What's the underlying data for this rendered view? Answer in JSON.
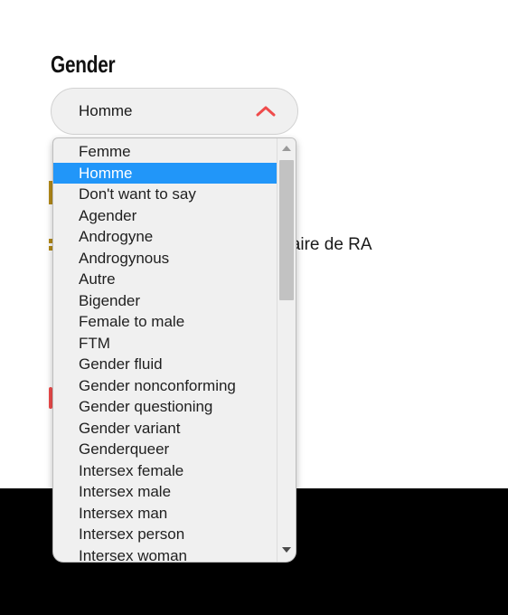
{
  "page": {
    "heading": "Gender",
    "background_text": "hebdomadaire de RA"
  },
  "select": {
    "name": "gender-select",
    "value": "Homme",
    "expanded": true,
    "toggle_icon": "chevron-up-icon",
    "accent_color": "#ef4b4b",
    "background_color": "#f0f0f0"
  },
  "dropdown": {
    "highlight_color": "#2196f9",
    "selected_value": "Homme",
    "scrollbar": {
      "up_icon": "scroll-up-arrow-icon",
      "down_icon": "scroll-down-arrow-icon",
      "thumb": "scrollbar-thumb"
    },
    "options": [
      "Femme",
      "Homme",
      "Don't want to say",
      "Agender",
      "Androgyne",
      "Androgynous",
      "Autre",
      "Bigender",
      "Female to male",
      "FTM",
      "Gender fluid",
      "Gender nonconforming",
      "Gender questioning",
      "Gender variant",
      "Genderqueer",
      "Intersex female",
      "Intersex male",
      "Intersex man",
      "Intersex person",
      "Intersex woman"
    ]
  }
}
